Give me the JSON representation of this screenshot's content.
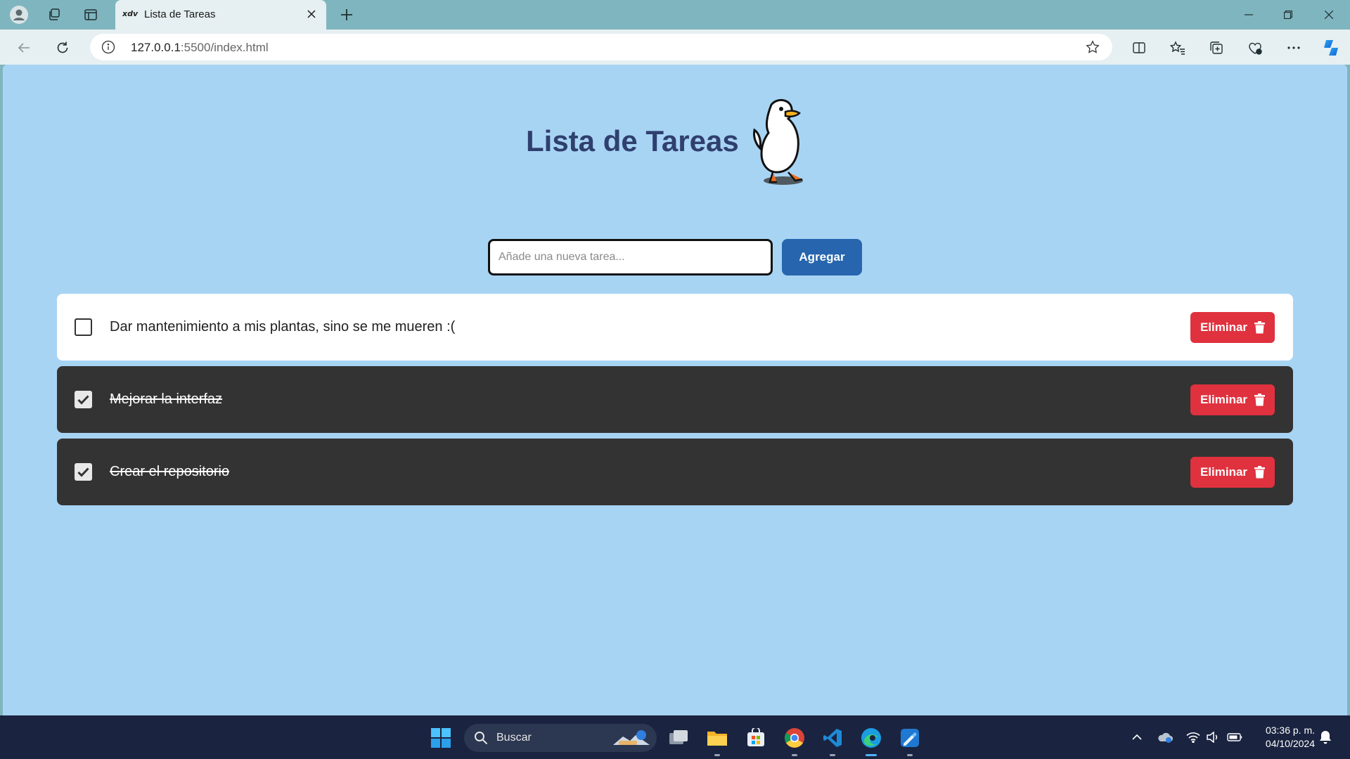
{
  "browser": {
    "tab_title": "Lista de Tareas",
    "tab_favicon_text": "xdv",
    "url_host": "127.0.0.1",
    "url_rest": ":5500/index.html"
  },
  "app": {
    "title": "Lista de Tareas",
    "input_placeholder": "Añade una nueva tarea...",
    "add_button": "Agregar",
    "tasks": [
      {
        "text": "Dar mantenimiento a mis plantas, sino se me mueren :(",
        "done": false,
        "delete_label": "Eliminar"
      },
      {
        "text": "Mejorar la interfaz",
        "done": true,
        "delete_label": "Eliminar"
      },
      {
        "text": "Crear el repositorio",
        "done": true,
        "delete_label": "Eliminar"
      }
    ],
    "colors": {
      "page_bg": "#a8d4f4",
      "title": "#2f3f6e",
      "add_button": "#2766ae",
      "delete_button": "#e0313e",
      "done_task_bg": "#333333"
    }
  },
  "taskbar": {
    "search_label": "Buscar",
    "time": "03:36 p. m.",
    "date": "04/10/2024"
  }
}
